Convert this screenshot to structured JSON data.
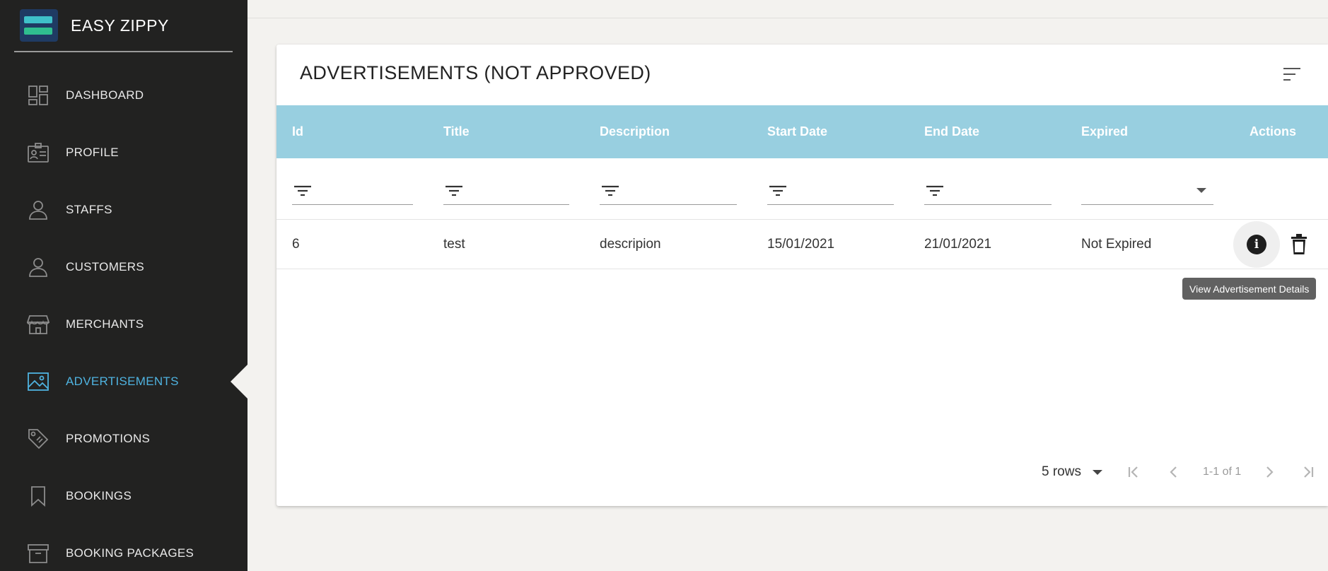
{
  "app": {
    "name": "EASY ZIPPY"
  },
  "sidebar": {
    "items": [
      {
        "label": "DASHBOARD",
        "icon": "dashboard-icon",
        "active": false
      },
      {
        "label": "PROFILE",
        "icon": "id-card-icon",
        "active": false
      },
      {
        "label": "STAFFS",
        "icon": "person-icon",
        "active": false
      },
      {
        "label": "CUSTOMERS",
        "icon": "person-icon",
        "active": false
      },
      {
        "label": "MERCHANTS",
        "icon": "store-icon",
        "active": false
      },
      {
        "label": "ADVERTISEMENTS",
        "icon": "image-icon",
        "active": true
      },
      {
        "label": "PROMOTIONS",
        "icon": "tag-icon",
        "active": false
      },
      {
        "label": "BOOKINGS",
        "icon": "bookmark-icon",
        "active": false
      },
      {
        "label": "BOOKING PACKAGES",
        "icon": "archive-icon",
        "active": false
      }
    ],
    "active_color": "#4fb3e0"
  },
  "main": {
    "title": "ADVERTISEMENTS (NOT APPROVED)",
    "header_color": "#98cfe0",
    "columns": [
      "Id",
      "Title",
      "Description",
      "Start Date",
      "End Date",
      "Expired",
      "Actions"
    ],
    "rows": [
      {
        "id": "6",
        "title": "test",
        "description": "descripion",
        "start_date": "15/01/2021",
        "end_date": "21/01/2021",
        "expired": "Not Expired"
      }
    ],
    "tooltip": "View Advertisement Details",
    "pagination": {
      "rows_per_page": "5 rows",
      "info": "1-1 of 1"
    }
  }
}
